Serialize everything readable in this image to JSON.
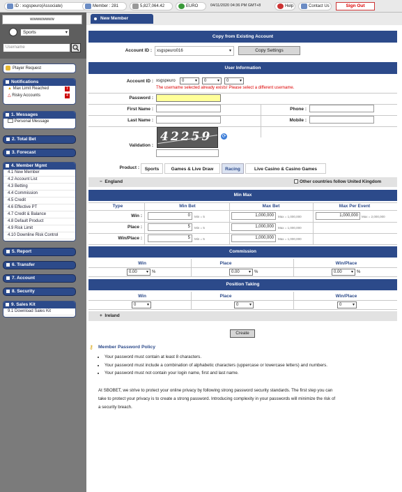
{
  "topbar": {
    "user_id": "ID : xsgspeuro(Associate)",
    "member": "Member : 281",
    "balance": "5,827,064.42",
    "currency": "EURO",
    "datetime": "04/11/2020 04:36 PM GMT+8",
    "help": "Help",
    "contact": "Contact Us",
    "signout": "Sign Out"
  },
  "sidebar": {
    "brand": "wwwwwwww",
    "sport_select": "Sports",
    "search_placeholder": "Username",
    "player_request": "Player Request",
    "notifications_title": "Notifications",
    "notifications": [
      {
        "label": "Max Limit Reached",
        "count": "1"
      },
      {
        "label": "Risky Accounts",
        "count": "4"
      }
    ],
    "messages_title": "1. Messages",
    "messages_item": "Personal Message",
    "total_bet": "2. Total Bet",
    "forecast": "3. Forecast",
    "member_mgmt_title": "4. Member Mgmt",
    "member_mgmt_items": [
      "4.1 New Member",
      "4.2 Account List",
      "4.3 Betting",
      "4.4 Commission",
      "4.5 Credit",
      "4.6 Effective PT",
      "4.7 Credit & Balance",
      "4.8 Default Product",
      "4.9 Risk Limit",
      "4.10 Downline Risk Control"
    ],
    "report": "5. Report",
    "transfer": "6. Transfer",
    "account": "7. Account",
    "security": "8. Security",
    "sales_kit_title": "9. Sales Kit",
    "sales_kit_item": "9.1 Download Sales Kit"
  },
  "main": {
    "tab_title": "New Member",
    "copy_title": "Copy from Existing Account",
    "copy_account_label": "Account ID :",
    "copy_account_value": "xsgspeuro016",
    "copy_button": "Copy Settings",
    "user_info_title": "User Information",
    "account_id_label": "Account ID :",
    "account_prefix": "xsgspeuro",
    "account_digits": [
      "0",
      "0",
      "0"
    ],
    "account_error": "The username selected already exists! Please select a different username.",
    "password_label": "Password :",
    "first_name_label": "First Name :",
    "last_name_label": "Last Name :",
    "phone_label": "Phone :",
    "mobile_label": "Mobile :",
    "validation_label": "Validation :",
    "captcha_text": "42259",
    "product_label": "Product :",
    "product_tabs": [
      "Sports",
      "Games & Live Draw",
      "Racing",
      "Live Casino & Casino Games"
    ],
    "active_product": "Racing",
    "region_england": "England",
    "other_countries": "Other countries follow United Kingdom",
    "minmax_title": "Min Max",
    "minmax_headers": [
      "Type",
      "Min Bet",
      "Max Bet",
      "Max Per Event"
    ],
    "minmax_rows": [
      {
        "type": "Win :",
        "min": "0",
        "min_note": "Min = 5",
        "max": "1,000,000",
        "max_note": "Max = 1,000,000",
        "per_event": "1,000,000",
        "per_event_note": "Max = 2,000,000"
      },
      {
        "type": "Place :",
        "min": "5",
        "min_note": "Min = 5",
        "max": "1,000,000",
        "max_note": "Max = 1,000,000"
      },
      {
        "type": "Win/Place :",
        "min": "5",
        "min_note": "Min = 5",
        "max": "1,000,000",
        "max_note": "Max = 1,000,000"
      }
    ],
    "commission_title": "Commission",
    "commission_headers": [
      "Win",
      "Place",
      "Win/Place"
    ],
    "commission_values": [
      "0.00",
      "0.00",
      "0.00"
    ],
    "percent": "%",
    "position_title": "Position Taking",
    "position_headers": [
      "Win",
      "Place",
      "Win/Place"
    ],
    "position_values": [
      "0",
      "0",
      "0"
    ],
    "region_ireland": "Ireland",
    "create_button": "Create",
    "policy_title": "Member Password Policy",
    "policy_items": [
      "Your password must contain at least 8 characters.",
      "Your password must include a combination of alphabetic characters (uppercase or lowercase letters) and numbers.",
      "Your password must not contain your login name, first and last name."
    ],
    "policy_para_1": "At SBOBET, we strive to protect your online privacy by following strong password security standards. The first step you can",
    "policy_para_2": "take to protect your privacy is to create a strong password. Introducing complexity in your passwords will minimize the risk of",
    "policy_para_3": "a security breach."
  },
  "colors": {
    "primary": "#2c4a8a",
    "error": "#dd0000",
    "sidebar": "#7b7b7b",
    "password_bg": "#ffff99"
  }
}
